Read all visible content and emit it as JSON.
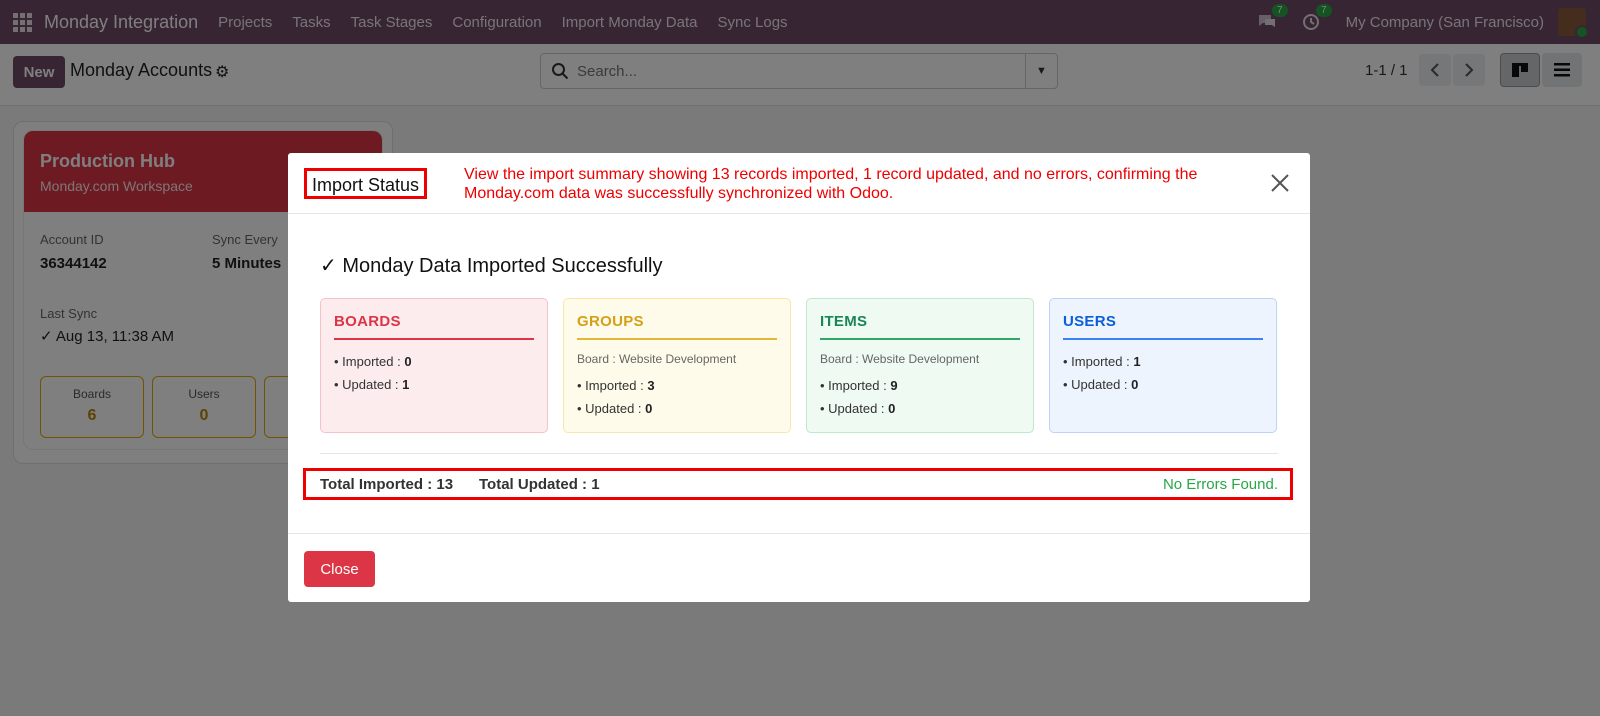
{
  "navbar": {
    "app_name": "Monday Integration",
    "menu": [
      "Projects",
      "Tasks",
      "Task Stages",
      "Configuration",
      "Import Monday Data",
      "Sync Logs"
    ],
    "messages_count": "7",
    "activities_count": "7",
    "company": "My Company (San Francisco)"
  },
  "control": {
    "new_label": "New",
    "breadcrumb": "Monday Accounts",
    "search_placeholder": "Search...",
    "pager": "1-1 / 1"
  },
  "card": {
    "title": "Production Hub",
    "subtitle": "Monday.com Workspace",
    "account_id_label": "Account ID",
    "account_id": "36344142",
    "sync_every_label": "Sync Every",
    "sync_every": "5 Minutes",
    "last_sync_label": "Last Sync",
    "last_sync": "✓ Aug 13, 11:38 AM",
    "stats": [
      {
        "label": "Boards",
        "value": "6"
      },
      {
        "label": "Users",
        "value": "0"
      }
    ]
  },
  "modal": {
    "title": "Import Status",
    "annotation": "View the import summary showing 13 records imported, 1 record updated, and no errors, confirming the Monday.com data was successfully synchronized with Odoo.",
    "success_message": "✓ Monday Data Imported Successfully",
    "cards": [
      {
        "title": "BOARDS",
        "sub": "",
        "imported": "0",
        "updated": "1",
        "color": "#dc3545",
        "bg": "#fdecee",
        "border": "#f5c2c7"
      },
      {
        "title": "GROUPS",
        "sub": "Board : Website Development",
        "imported": "3",
        "updated": "0",
        "color": "#d4a017",
        "bg": "#fffbea",
        "border": "#fae6a8"
      },
      {
        "title": "ITEMS",
        "sub": "Board : Website Development",
        "imported": "9",
        "updated": "0",
        "color": "#198754",
        "bg": "#eefaf2",
        "border": "#bfe8cc"
      },
      {
        "title": "USERS",
        "sub": "",
        "imported": "1",
        "updated": "0",
        "color": "#0d6efd",
        "bg": "#eef4fd",
        "border": "#bcd3f5"
      }
    ],
    "imported_prefix": "• Imported : ",
    "updated_prefix": "• Updated : ",
    "total_imported_label": "Total Imported : ",
    "total_imported": "13",
    "total_updated_label": "Total Updated : ",
    "total_updated": "1",
    "no_errors": "No Errors Found.",
    "close_label": "Close"
  }
}
